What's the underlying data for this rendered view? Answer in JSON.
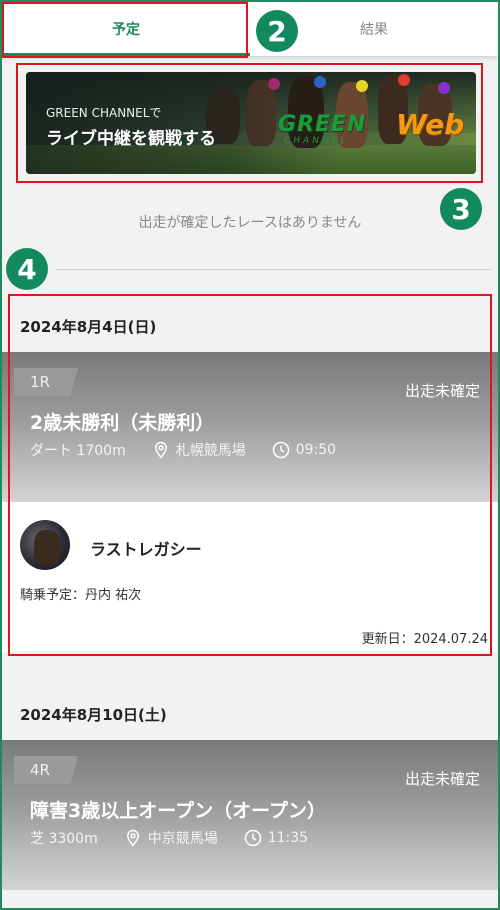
{
  "tabs": [
    {
      "label": "予定",
      "active": true
    },
    {
      "label": "結果",
      "active": false
    }
  ],
  "markers": [
    "2",
    "3",
    "4"
  ],
  "banner": {
    "line1": "GREEN CHANNELで",
    "line2": "ライブ中継を観戦する",
    "logo_main": "GREEN",
    "logo_web": "Web",
    "logo_sub": "CHANNEL"
  },
  "empty_message": "出走が確定したレースはありません",
  "races": [
    {
      "date": "2024年8月4日(日)",
      "race_no": "1R",
      "status": "出走未確定",
      "title": "2歳未勝利（未勝利）",
      "course": "ダート 1700m",
      "venue": "札幌競馬場",
      "time": "09:50",
      "entry": {
        "horse": "ラストレガシー",
        "jockey": "騎乗予定：丹内 祐次",
        "updated": "更新日：2024.07.24"
      }
    },
    {
      "date": "2024年8月10日(土)",
      "race_no": "4R",
      "status": "出走未確定",
      "title": "障害3歳以上オープン（オープン）",
      "course": "芝 3300m",
      "venue": "中京競馬場",
      "time": "11:35"
    }
  ],
  "colors": {
    "accent": "#1b8a5a",
    "highlight": "#e0141e",
    "marker": "#138a5e"
  }
}
